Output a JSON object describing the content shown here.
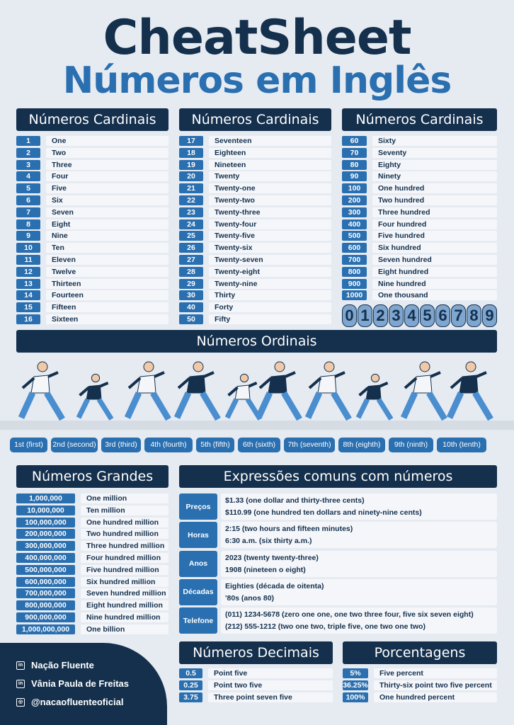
{
  "title": "CheatSheet",
  "subtitle": "Números em Inglês",
  "cardinals": {
    "header": "Números Cardinais",
    "columns": [
      [
        [
          "1",
          "One"
        ],
        [
          "2",
          "Two"
        ],
        [
          "3",
          "Three"
        ],
        [
          "4",
          "Four"
        ],
        [
          "5",
          "Five"
        ],
        [
          "6",
          "Six"
        ],
        [
          "7",
          "Seven"
        ],
        [
          "8",
          "Eight"
        ],
        [
          "9",
          "Nine"
        ],
        [
          "10",
          "Ten"
        ],
        [
          "11",
          "Eleven"
        ],
        [
          "12",
          "Twelve"
        ],
        [
          "13",
          "Thirteen"
        ],
        [
          "14",
          "Fourteen"
        ],
        [
          "15",
          "Fifteen"
        ],
        [
          "16",
          "Sixteen"
        ]
      ],
      [
        [
          "17",
          "Seventeen"
        ],
        [
          "18",
          "Eighteen"
        ],
        [
          "19",
          "Nineteen"
        ],
        [
          "20",
          "Twenty"
        ],
        [
          "21",
          "Twenty-one"
        ],
        [
          "22",
          "Twenty-two"
        ],
        [
          "23",
          "Twenty-three"
        ],
        [
          "24",
          "Twenty-four"
        ],
        [
          "25",
          "Twenty-five"
        ],
        [
          "26",
          "Twenty-six"
        ],
        [
          "27",
          "Twenty-seven"
        ],
        [
          "28",
          "Twenty-eight"
        ],
        [
          "29",
          "Twenty-nine"
        ],
        [
          "30",
          "Thirty"
        ],
        [
          "40",
          "Forty"
        ],
        [
          "50",
          "Fifty"
        ]
      ],
      [
        [
          "60",
          "Sixty"
        ],
        [
          "70",
          "Seventy"
        ],
        [
          "80",
          "Eighty"
        ],
        [
          "90",
          "Ninety"
        ],
        [
          "100",
          "One hundred"
        ],
        [
          "200",
          "Two hundred"
        ],
        [
          "300",
          "Three hundred"
        ],
        [
          "400",
          "Four hundred"
        ],
        [
          "500",
          "Five hundred"
        ],
        [
          "600",
          "Six hundred"
        ],
        [
          "700",
          "Seven hundred"
        ],
        [
          "800",
          "Eight hundred"
        ],
        [
          "900",
          "Nine hundred"
        ],
        [
          "1000",
          "One thousand"
        ]
      ]
    ],
    "digits": [
      "0",
      "1",
      "2",
      "3",
      "4",
      "5",
      "6",
      "7",
      "8",
      "9"
    ]
  },
  "ordinals": {
    "header": "Números Ordinais",
    "items": [
      "1st (first)",
      "2nd (second)",
      "3rd (third)",
      "4th (fourth)",
      "5th (fifth)",
      "6th (sixth)",
      "7th (seventh)",
      "8th (eighth)",
      "9th (ninth)",
      "10th (tenth)"
    ]
  },
  "large": {
    "header": "Números Grandes",
    "items": [
      [
        "1,000,000",
        "One million"
      ],
      [
        "10,000,000",
        "Ten million"
      ],
      [
        "100,000,000",
        "One hundred million"
      ],
      [
        "200,000,000",
        "Two hundred million"
      ],
      [
        "300,000,000",
        "Three hundred million"
      ],
      [
        "400,000,000",
        "Four hundred million"
      ],
      [
        "500,000,000",
        "Five hundred million"
      ],
      [
        "600,000,000",
        "Six hundred million"
      ],
      [
        "700,000,000",
        "Seven hundred million"
      ],
      [
        "800,000,000",
        "Eight hundred million"
      ],
      [
        "900,000,000",
        "Nine hundred million"
      ],
      [
        "1,000,000,000",
        "One billion"
      ]
    ]
  },
  "expressions": {
    "header": "Expressões comuns com números",
    "items": [
      {
        "label": "Preços",
        "lines": [
          "$1.33 (one dollar and thirty-three cents)",
          "$110.99 (one hundred ten dollars and ninety-nine cents)"
        ]
      },
      {
        "label": "Horas",
        "lines": [
          "2:15 (two hours and fifteen minutes)",
          "6:30 a.m. (six thirty a.m.)"
        ]
      },
      {
        "label": "Anos",
        "lines": [
          "2023 (twenty twenty-three)",
          "1908 (nineteen o eight)"
        ]
      },
      {
        "label": "Décadas",
        "lines": [
          "Eighties (década de oitenta)",
          "'80s (anos 80)"
        ]
      },
      {
        "label": "Telefone",
        "lines": [
          "(011) 1234-5678 (zero one one, one two three four, five six seven eight)",
          "(212) 555-1212 (two one two, triple five, one two one two)"
        ]
      }
    ]
  },
  "decimals": {
    "header": "Números Decimais",
    "items": [
      [
        "0.5",
        "Point five"
      ],
      [
        "0.25",
        "Point two five"
      ],
      [
        "3.75",
        "Three point seven five"
      ]
    ]
  },
  "percentages": {
    "header": "Porcentagens",
    "items": [
      [
        "5%",
        "Five percent"
      ],
      [
        "36.25%",
        "Thirty-six point two five percent"
      ],
      [
        "100%",
        "One hundred percent"
      ]
    ]
  },
  "footer": [
    {
      "icon": "linkedin-icon",
      "text": "Nação Fluente"
    },
    {
      "icon": "linkedin-icon",
      "text": "Vânia Paula de Freitas"
    },
    {
      "icon": "instagram-icon",
      "text": "@nacaofluenteoficial"
    }
  ],
  "colors": {
    "navy": "#14304d",
    "blue": "#2a6fb0",
    "bg": "#e6ebf2"
  }
}
